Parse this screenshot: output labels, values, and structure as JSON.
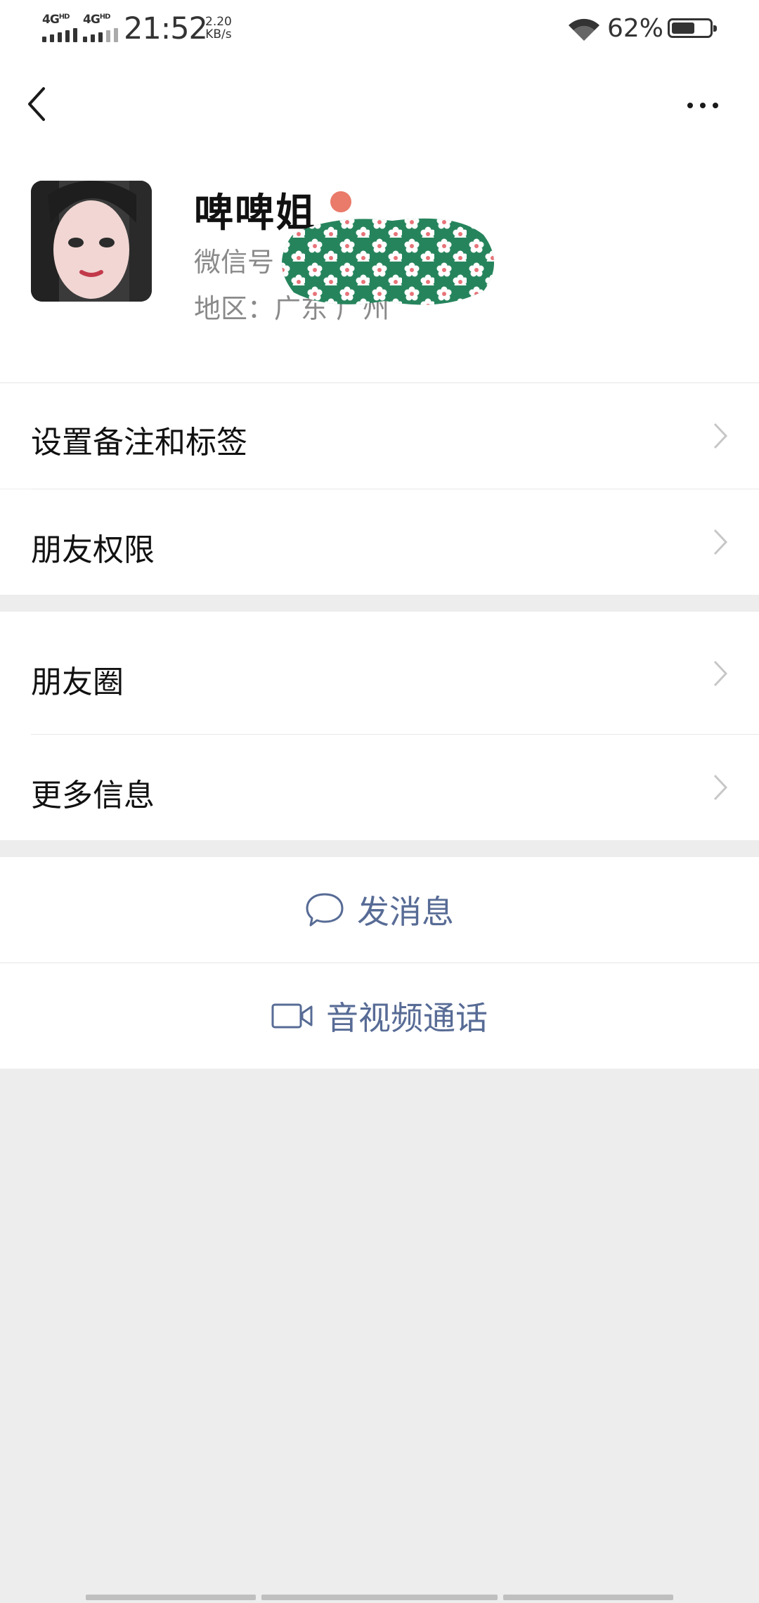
{
  "status_bar": {
    "network1": "4G",
    "network1_sup": "HD",
    "network2": "4G",
    "network2_sup": "HD",
    "time": "21:52",
    "speed_value": "2.20",
    "speed_unit": "KB/s",
    "battery_percent": "62%",
    "battery_level": 0.62
  },
  "profile": {
    "name": "啤啤姐",
    "wechat_id_label": "微信号",
    "region": "地区：广东 广州"
  },
  "menu_group1": [
    {
      "label": "设置备注和标签"
    },
    {
      "label": "朋友权限"
    }
  ],
  "menu_group2": [
    {
      "label": "朋友圈"
    },
    {
      "label": "更多信息"
    }
  ],
  "actions": {
    "send_message": "发消息",
    "av_call": "音视频通话"
  },
  "colors": {
    "link_blue": "#576b95",
    "background": "#ededed",
    "redaction_green": "#26845c"
  }
}
